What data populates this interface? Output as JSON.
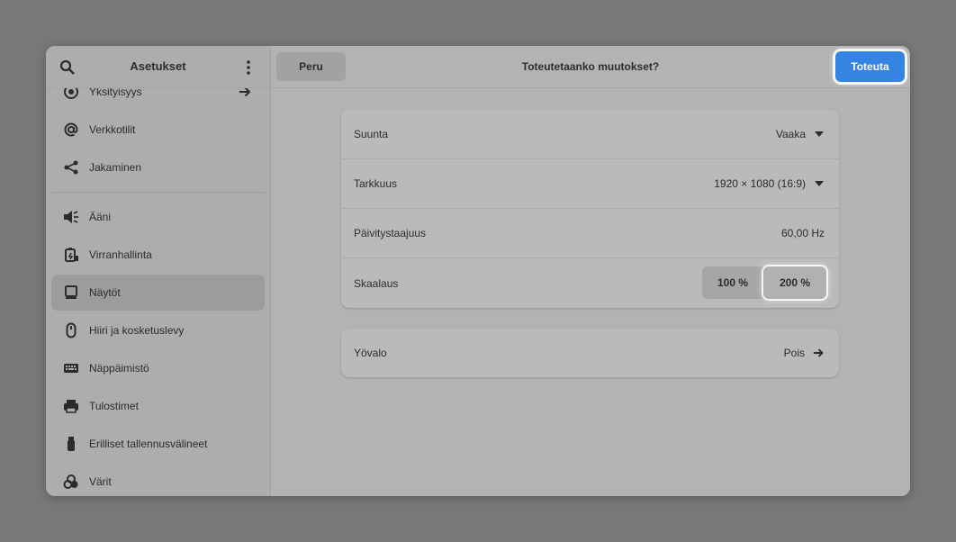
{
  "sidebar": {
    "title": "Asetukset",
    "items": [
      {
        "label": "Yksityisyys",
        "icon": "privacy-icon"
      },
      {
        "label": "Verkkotilit",
        "icon": "at-sign-icon"
      },
      {
        "label": "Jakaminen",
        "icon": "share-icon"
      },
      {
        "label": "Ääni",
        "icon": "speaker-icon"
      },
      {
        "label": "Virranhallinta",
        "icon": "battery-icon"
      },
      {
        "label": "Näytöt",
        "icon": "display-icon"
      },
      {
        "label": "Hiiri ja kosketuslevy",
        "icon": "mouse-icon"
      },
      {
        "label": "Näppäimistö",
        "icon": "keyboard-icon"
      },
      {
        "label": "Tulostimet",
        "icon": "printer-icon"
      },
      {
        "label": "Erilliset tallennusvälineet",
        "icon": "usb-icon"
      },
      {
        "label": "Värit",
        "icon": "color-icon"
      }
    ],
    "active_item": "Näytöt"
  },
  "header": {
    "cancel_label": "Peru",
    "title": "Toteutetaanko muutokset?",
    "apply_label": "Toteuta",
    "apply_color": "#3584e4"
  },
  "display_settings": {
    "orientation": {
      "label": "Suunta",
      "value": "Vaaka"
    },
    "resolution": {
      "label": "Tarkkuus",
      "value": "1920 × 1080 (16:9)"
    },
    "refresh_rate": {
      "label": "Päivitystaajuus",
      "value": "60,00 Hz"
    },
    "scale": {
      "label": "Skaalaus",
      "options": [
        "100 %",
        "200 %"
      ],
      "selected": "200 %"
    }
  },
  "night_light": {
    "label": "Yövalo",
    "value": "Pois"
  }
}
